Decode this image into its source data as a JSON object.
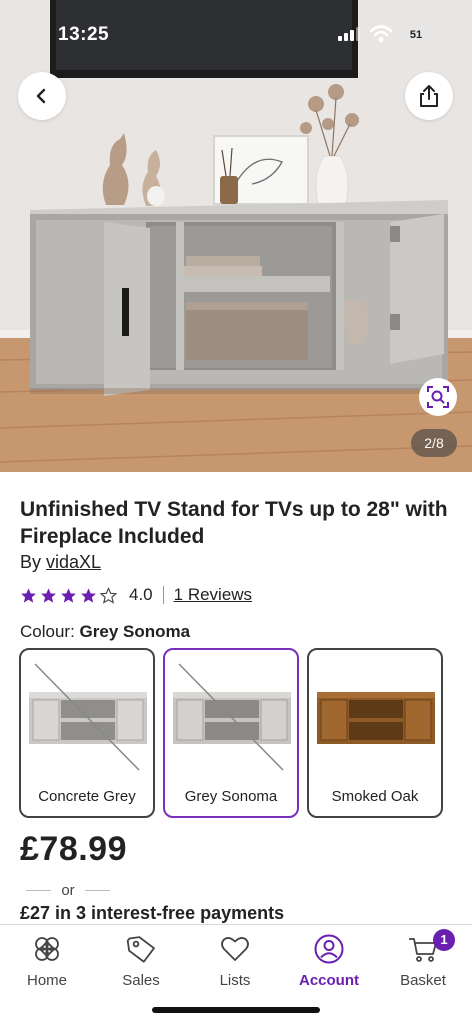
{
  "status_bar": {
    "time": "13:25",
    "battery": "51"
  },
  "gallery": {
    "counter": "2/8"
  },
  "product": {
    "title": "Unfinished TV Stand for TVs up to 28\" with Fireplace Included",
    "brand_prefix": "By ",
    "brand": "vidaXL",
    "rating_value": "4.0",
    "rating_stars": 4,
    "reviews_link": "1 Reviews",
    "colour_label": "Colour: ",
    "selected_colour": "Grey Sonoma",
    "swatches": [
      {
        "label": "Concrete Grey",
        "available": false,
        "selected": false
      },
      {
        "label": "Grey Sonoma",
        "available": false,
        "selected": true
      },
      {
        "label": "Smoked Oak",
        "available": true,
        "selected": false
      }
    ],
    "price": "£78.99",
    "or_text": "or",
    "installments": "£27 in 3 interest-free payments"
  },
  "nav": {
    "items": [
      {
        "label": "Home",
        "icon": "home-icon"
      },
      {
        "label": "Sales",
        "icon": "tag-icon"
      },
      {
        "label": "Lists",
        "icon": "heart-icon"
      },
      {
        "label": "Account",
        "icon": "account-icon",
        "active": true
      },
      {
        "label": "Basket",
        "icon": "basket-icon",
        "badge": "1"
      }
    ]
  },
  "colors": {
    "accent": "#6a1fb0",
    "selected_border": "#7b2fbe",
    "star": "#6a1fb0"
  }
}
